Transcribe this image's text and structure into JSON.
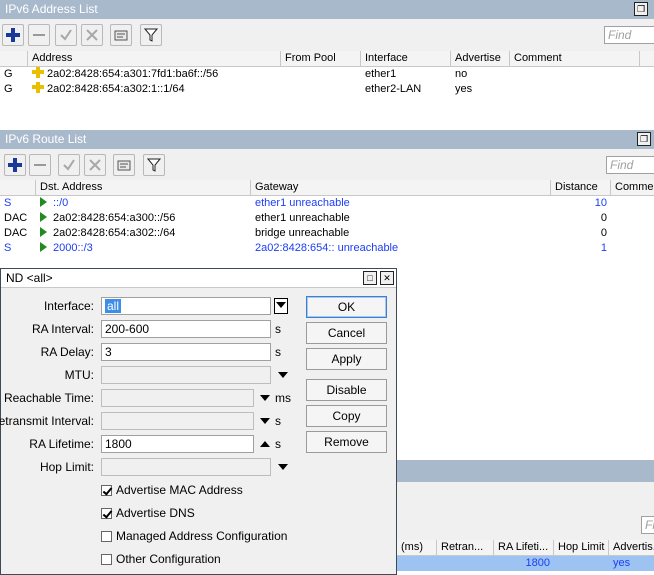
{
  "address_list": {
    "title": "IPv6 Address List",
    "find_placeholder": "Find",
    "columns": [
      "Address",
      "From Pool",
      "Interface",
      "Advertise",
      "Comment"
    ],
    "rows": [
      {
        "flag": "G",
        "address": "2a02:8428:654:a301:7fd1:ba6f::/56",
        "from_pool": "",
        "interface": "ether1",
        "advertise": "no"
      },
      {
        "flag": "G",
        "address": "2a02:8428:654:a302:1::1/64",
        "from_pool": "",
        "interface": "ether2-LAN",
        "advertise": "yes"
      }
    ]
  },
  "route_list": {
    "title": "IPv6 Route List",
    "find_placeholder": "Find",
    "columns": [
      "Dst. Address",
      "Gateway",
      "Distance",
      "Comment"
    ],
    "rows": [
      {
        "flag": "S",
        "dst": "::/0",
        "gateway": "ether1 unreachable",
        "distance": "10"
      },
      {
        "flag": "DAC",
        "dst": "2a02:8428:654:a300::/56",
        "gateway": "ether1 unreachable",
        "distance": "0"
      },
      {
        "flag": "DAC",
        "dst": "2a02:8428:654:a302::/64",
        "gateway": "bridge unreachable",
        "distance": "0"
      },
      {
        "flag": "S",
        "dst": "2000::/3",
        "gateway": "2a02:8428:654:: unreachable",
        "distance": "1"
      }
    ]
  },
  "nd_list": {
    "find_placeholder": "Find",
    "columns": [
      "(ms)",
      "Retran...",
      "RA Lifeti...",
      "Hop Limit",
      "Advertis..."
    ],
    "row": {
      "ra_lifetime": "1800",
      "advertise": "yes"
    }
  },
  "nd_dialog": {
    "title": "ND <all>",
    "labels": {
      "interface": "Interface:",
      "ra_interval": "RA Interval:",
      "ra_delay": "RA Delay:",
      "mtu": "MTU:",
      "reachable_time": "Reachable Time:",
      "retransmit_interval": "Retransmit Interval:",
      "ra_lifetime": "RA Lifetime:",
      "hop_limit": "Hop Limit:"
    },
    "values": {
      "interface": "all",
      "ra_interval": "200-600",
      "ra_delay": "3",
      "ra_lifetime": "1800"
    },
    "units": {
      "s": "s",
      "ms": "ms"
    },
    "checkboxes": [
      {
        "label": "Advertise MAC Address",
        "checked": true
      },
      {
        "label": "Advertise DNS",
        "checked": true
      },
      {
        "label": "Managed Address Configuration",
        "checked": false
      },
      {
        "label": "Other Configuration",
        "checked": false
      }
    ],
    "buttons": {
      "ok": "OK",
      "cancel": "Cancel",
      "apply": "Apply",
      "disable": "Disable",
      "copy": "Copy",
      "remove": "Remove"
    }
  },
  "colors": {
    "titlebar": "#a9b9cc",
    "link_blue": "#1c3ef5",
    "selection": "#9dc3f2",
    "flag_green": "#1f8c1f"
  }
}
